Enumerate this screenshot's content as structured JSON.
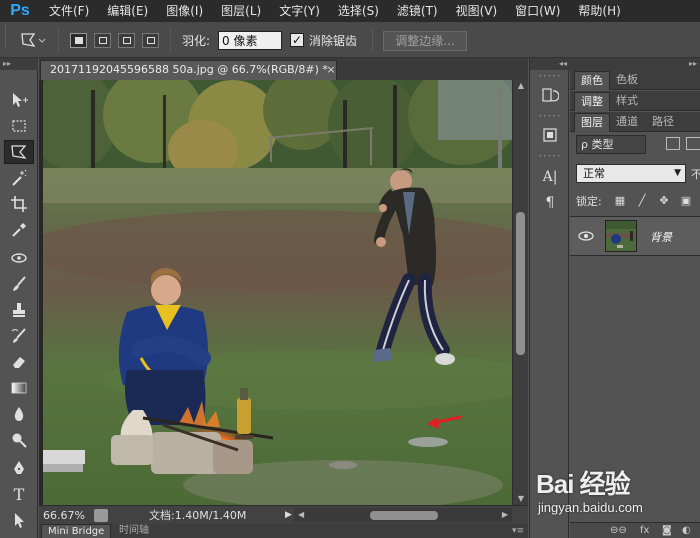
{
  "app": {
    "logo": "Ps"
  },
  "menu": {
    "items": [
      "文件(F)",
      "编辑(E)",
      "图像(I)",
      "图层(L)",
      "文字(Y)",
      "选择(S)",
      "滤镜(T)",
      "视图(V)",
      "窗口(W)",
      "帮助(H)"
    ]
  },
  "options": {
    "feather_label": "羽化:",
    "feather_value": "0 像素",
    "antialias_checked": true,
    "antialias_mark": "✓",
    "antialias_label": "消除锯齿",
    "refine_edge_label": "调整边缘..."
  },
  "document": {
    "tab_title": "20171192045596588 50a.jpg @ 66.7%(RGB/8#) *",
    "close_glyph": "×"
  },
  "status": {
    "zoom": "66.67%",
    "doc_info": "文档:1.40M/1.40M"
  },
  "bottom_tabs": {
    "mini_bridge": "Mini Bridge",
    "timeline": "时间轴"
  },
  "panels": {
    "row1": {
      "tab1": "颜色",
      "tab2": "色板"
    },
    "row2": {
      "tab1": "调整",
      "tab2": "样式"
    },
    "row3": {
      "tab1": "图层",
      "tab2": "通道",
      "tab3": "路径"
    },
    "filter_label": "ρ 类型",
    "blend_mode": "正常",
    "opacity_stub": "不",
    "lock_label": "锁定:",
    "layer_name": "背景"
  },
  "watermark": {
    "brand": "Bai 经验",
    "url": "jingyan.baidu.com"
  },
  "colors": {
    "ps_blue": "#31a8ff",
    "arrow_red": "#e02020"
  }
}
